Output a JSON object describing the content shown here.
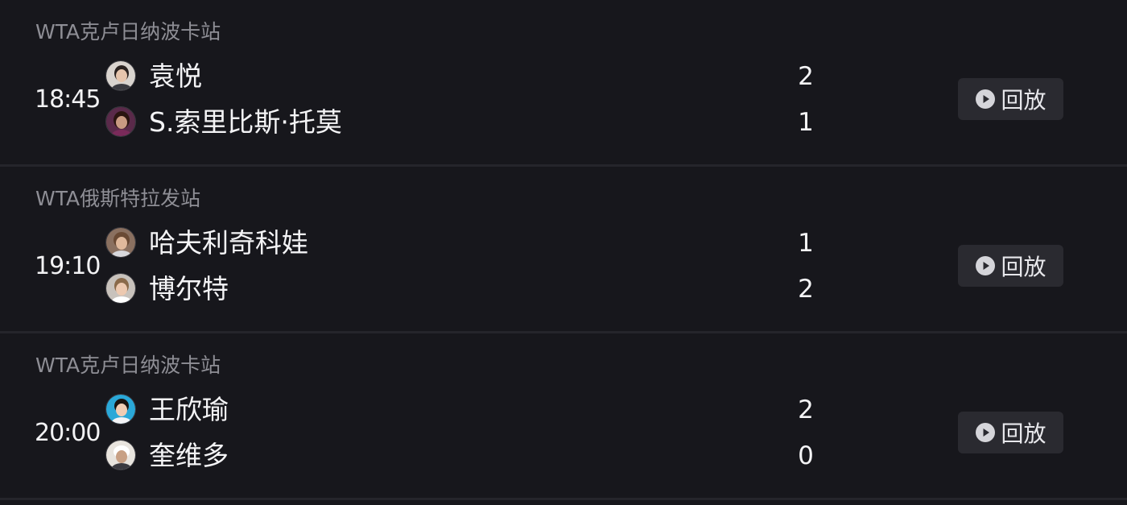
{
  "matches": [
    {
      "tournament": "WTA克卢日纳波卡站",
      "time": "18:45",
      "players": [
        {
          "name": "袁悦",
          "score": "2",
          "avatar_icon": "player-avatar-icon"
        },
        {
          "name": "S.索里比斯·托莫",
          "score": "1",
          "avatar_icon": "player-avatar-icon"
        }
      ],
      "replay_label": "回放"
    },
    {
      "tournament": "WTA俄斯特拉发站",
      "time": "19:10",
      "players": [
        {
          "name": "哈夫利奇科娃",
          "score": "1",
          "avatar_icon": "player-avatar-icon"
        },
        {
          "name": "博尔特",
          "score": "2",
          "avatar_icon": "player-avatar-icon"
        }
      ],
      "replay_label": "回放"
    },
    {
      "tournament": "WTA克卢日纳波卡站",
      "time": "20:00",
      "players": [
        {
          "name": "王欣瑜",
          "score": "2",
          "avatar_icon": "player-avatar-icon"
        },
        {
          "name": "奎维多",
          "score": "0",
          "avatar_icon": "player-avatar-icon"
        }
      ],
      "replay_label": "回放"
    }
  ],
  "colors": {
    "background": "#17171c",
    "divider": "#25252b",
    "button_bg": "#2a2a30",
    "secondary_text": "#8e8e95"
  }
}
